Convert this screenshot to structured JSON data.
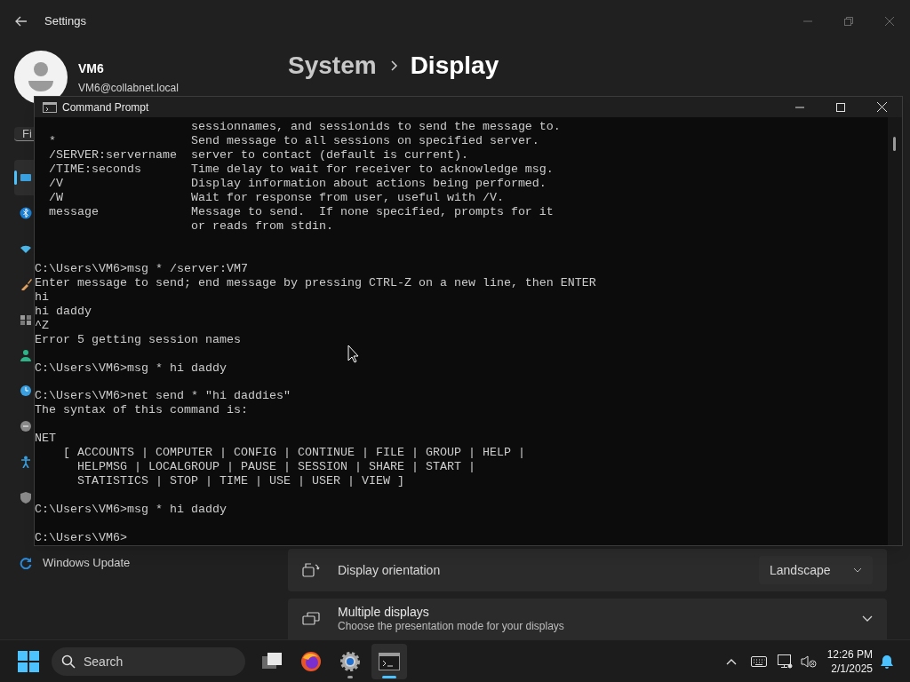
{
  "settings_window": {
    "title": "Settings",
    "user": {
      "name": "VM6",
      "email": "VM6@collabnet.local"
    },
    "breadcrumb": [
      "System",
      "Display"
    ],
    "search": {
      "placeholder": "Fi"
    },
    "nav_items": [
      {
        "selected": true
      },
      {
        "selected": false
      },
      {
        "selected": false
      },
      {
        "selected": false
      },
      {
        "selected": false
      },
      {
        "selected": false
      },
      {
        "selected": false
      },
      {
        "selected": false
      },
      {
        "selected": false
      },
      {
        "selected": false
      },
      {
        "selected": false,
        "label": "Windows Update"
      }
    ],
    "settings": [
      {
        "kind": "dropdown",
        "label": "Display orientation",
        "value": "Landscape"
      },
      {
        "kind": "expander",
        "label": "Multiple displays",
        "description": "Choose the presentation mode for your displays"
      }
    ]
  },
  "command_prompt": {
    "title": "Command Prompt",
    "lines": [
      {
        "kind": "text",
        "text": "                      sessionnames, and sessionids to send the message to."
      },
      {
        "kind": "text",
        "text": "  *                   Send message to all sessions on specified server."
      },
      {
        "kind": "text",
        "text": "  /SERVER:servername  server to contact (default is current)."
      },
      {
        "kind": "text",
        "text": "  /TIME:seconds       Time delay to wait for receiver to acknowledge msg."
      },
      {
        "kind": "text",
        "text": "  /V                  Display information about actions being performed."
      },
      {
        "kind": "text",
        "text": "  /W                  Wait for response from user, useful with /V."
      },
      {
        "kind": "text",
        "text": "  message             Message to send.  If none specified, prompts for it"
      },
      {
        "kind": "text",
        "text": "                      or reads from stdin."
      },
      {
        "kind": "blank"
      },
      {
        "kind": "blank"
      },
      {
        "kind": "text",
        "text": "C:\\Users\\VM6>msg * /server:VM7"
      },
      {
        "kind": "text",
        "text": "Enter message to send; end message by pressing CTRL-Z on a new line, then ENTER"
      },
      {
        "kind": "text",
        "text": "hi"
      },
      {
        "kind": "text",
        "text": "hi daddy"
      },
      {
        "kind": "text",
        "text": "^Z"
      },
      {
        "kind": "text",
        "text": "Error 5 getting session names"
      },
      {
        "kind": "blank"
      },
      {
        "kind": "text",
        "text": "C:\\Users\\VM6>msg * hi daddy"
      },
      {
        "kind": "blank"
      },
      {
        "kind": "text",
        "text": "C:\\Users\\VM6>net send * \"hi daddies\""
      },
      {
        "kind": "text",
        "text": "The syntax of this command is:"
      },
      {
        "kind": "blank"
      },
      {
        "kind": "text",
        "text": "NET"
      },
      {
        "kind": "text",
        "text": "    [ ACCOUNTS | COMPUTER | CONFIG | CONTINUE | FILE | GROUP | HELP |"
      },
      {
        "kind": "text",
        "text": "      HELPMSG | LOCALGROUP | PAUSE | SESSION | SHARE | START |"
      },
      {
        "kind": "text",
        "text": "      STATISTICS | STOP | TIME | USE | USER | VIEW ]"
      },
      {
        "kind": "blank"
      },
      {
        "kind": "text",
        "text": "C:\\Users\\VM6>msg * hi daddy"
      },
      {
        "kind": "blank"
      },
      {
        "kind": "text",
        "text": "C:\\Users\\VM6>"
      }
    ]
  },
  "taskbar": {
    "search_placeholder": "Search",
    "apps": [
      {
        "kind": "task-view",
        "selected": false,
        "running": false
      },
      {
        "kind": "browser",
        "selected": false,
        "running": false
      },
      {
        "kind": "settings",
        "selected": false,
        "running": true
      },
      {
        "kind": "terminal",
        "selected": true,
        "running": true
      }
    ],
    "time": "12:26 PM",
    "date": "2/1/2025"
  }
}
